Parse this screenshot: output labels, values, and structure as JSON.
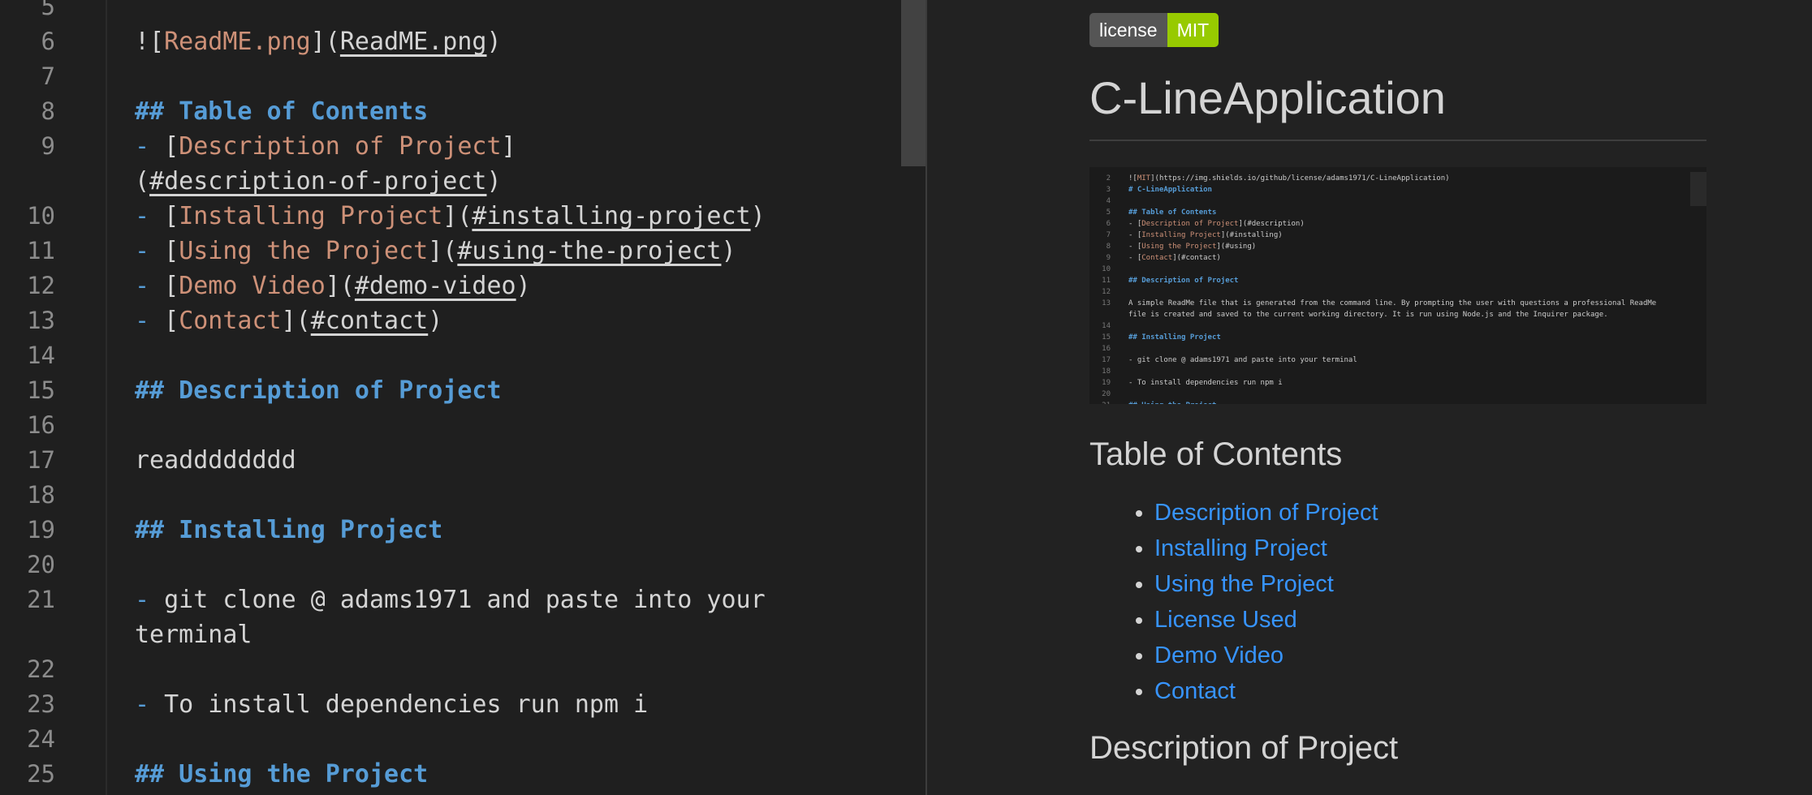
{
  "editor": {
    "lines": [
      {
        "num": "5",
        "segments": []
      },
      {
        "num": "6",
        "segments": [
          {
            "text": "![",
            "cls": ""
          },
          {
            "text": "ReadME.png",
            "cls": "t"
          },
          {
            "text": "](",
            "cls": ""
          },
          {
            "text": "ReadME.png",
            "cls": "u"
          },
          {
            "text": ")",
            "cls": ""
          }
        ]
      },
      {
        "num": "7",
        "segments": []
      },
      {
        "num": "8",
        "segments": [
          {
            "text": "## Table of Contents",
            "cls": "h"
          }
        ]
      },
      {
        "num": "9",
        "segments": [
          {
            "text": "- ",
            "cls": "d"
          },
          {
            "text": "[",
            "cls": ""
          },
          {
            "text": "Description of Project",
            "cls": "t"
          },
          {
            "text": "]",
            "cls": ""
          }
        ]
      },
      {
        "num": "",
        "segments": [
          {
            "text": "(",
            "cls": ""
          },
          {
            "text": "#description-of-project",
            "cls": "u"
          },
          {
            "text": ")",
            "cls": ""
          }
        ]
      },
      {
        "num": "10",
        "segments": [
          {
            "text": "- ",
            "cls": "d"
          },
          {
            "text": "[",
            "cls": ""
          },
          {
            "text": "Installing Project",
            "cls": "t"
          },
          {
            "text": "](",
            "cls": ""
          },
          {
            "text": "#installing-project",
            "cls": "u"
          },
          {
            "text": ")",
            "cls": ""
          }
        ]
      },
      {
        "num": "11",
        "segments": [
          {
            "text": "- ",
            "cls": "d"
          },
          {
            "text": "[",
            "cls": ""
          },
          {
            "text": "Using the Project",
            "cls": "t"
          },
          {
            "text": "](",
            "cls": ""
          },
          {
            "text": "#using-the-project",
            "cls": "u"
          },
          {
            "text": ")",
            "cls": ""
          }
        ]
      },
      {
        "num": "12",
        "segments": [
          {
            "text": "- ",
            "cls": "d"
          },
          {
            "text": "[",
            "cls": ""
          },
          {
            "text": "Demo Video",
            "cls": "t"
          },
          {
            "text": "](",
            "cls": ""
          },
          {
            "text": "#demo-video",
            "cls": "u"
          },
          {
            "text": ")",
            "cls": ""
          }
        ]
      },
      {
        "num": "13",
        "segments": [
          {
            "text": "- ",
            "cls": "d"
          },
          {
            "text": "[",
            "cls": ""
          },
          {
            "text": "Contact",
            "cls": "t"
          },
          {
            "text": "](",
            "cls": ""
          },
          {
            "text": "#contact",
            "cls": "u"
          },
          {
            "text": ")",
            "cls": ""
          }
        ]
      },
      {
        "num": "14",
        "segments": []
      },
      {
        "num": "15",
        "segments": [
          {
            "text": "## Description of Project",
            "cls": "h"
          }
        ]
      },
      {
        "num": "16",
        "segments": []
      },
      {
        "num": "17",
        "segments": [
          {
            "text": "readddddddd",
            "cls": ""
          }
        ]
      },
      {
        "num": "18",
        "segments": []
      },
      {
        "num": "19",
        "segments": [
          {
            "text": "## Installing Project",
            "cls": "h"
          }
        ]
      },
      {
        "num": "20",
        "segments": []
      },
      {
        "num": "21",
        "segments": [
          {
            "text": "- ",
            "cls": "d"
          },
          {
            "text": "git clone @ adams1971 and paste into your",
            "cls": ""
          }
        ]
      },
      {
        "num": "",
        "segments": [
          {
            "text": "terminal",
            "cls": ""
          }
        ]
      },
      {
        "num": "22",
        "segments": []
      },
      {
        "num": "23",
        "segments": [
          {
            "text": "- ",
            "cls": "d"
          },
          {
            "text": "To install dependencies run npm i",
            "cls": ""
          }
        ]
      },
      {
        "num": "24",
        "segments": []
      },
      {
        "num": "25",
        "segments": [
          {
            "text": "## Using the Project",
            "cls": "h"
          }
        ]
      }
    ]
  },
  "preview": {
    "badge_label": "license",
    "badge_value": "MIT",
    "title": "C-LineApplication",
    "screenshot_lines": [
      {
        "num": "2",
        "segments": [
          {
            "text": "![",
            "cls": ""
          },
          {
            "text": "MIT",
            "cls": "s-t"
          },
          {
            "text": "](https://img.shields.io/github/license/adams1971/C-LineApplication)",
            "cls": ""
          }
        ]
      },
      {
        "num": "3",
        "segments": [
          {
            "text": "# C-LineApplication",
            "cls": "s-h"
          }
        ]
      },
      {
        "num": "4",
        "segments": []
      },
      {
        "num": "5",
        "segments": [
          {
            "text": "## Table of Contents",
            "cls": "s-h"
          }
        ]
      },
      {
        "num": "6",
        "segments": [
          {
            "text": "- [",
            "cls": ""
          },
          {
            "text": "Description of Project",
            "cls": "s-t"
          },
          {
            "text": "](#description)",
            "cls": ""
          }
        ]
      },
      {
        "num": "7",
        "segments": [
          {
            "text": "- [",
            "cls": ""
          },
          {
            "text": "Installing Project",
            "cls": "s-t"
          },
          {
            "text": "](#installing)",
            "cls": ""
          }
        ]
      },
      {
        "num": "8",
        "segments": [
          {
            "text": "- [",
            "cls": ""
          },
          {
            "text": "Using the Project",
            "cls": "s-t"
          },
          {
            "text": "](#using)",
            "cls": ""
          }
        ]
      },
      {
        "num": "9",
        "segments": [
          {
            "text": "- [",
            "cls": ""
          },
          {
            "text": "Contact",
            "cls": "s-t"
          },
          {
            "text": "](#contact)",
            "cls": ""
          }
        ]
      },
      {
        "num": "10",
        "segments": []
      },
      {
        "num": "11",
        "segments": [
          {
            "text": "## Description of Project",
            "cls": "s-h"
          }
        ]
      },
      {
        "num": "12",
        "segments": []
      },
      {
        "num": "13",
        "segments": [
          {
            "text": "A simple ReadMe file that is generated from the command line. By prompting the user with questions a professional ReadMe",
            "cls": ""
          }
        ]
      },
      {
        "num": "",
        "segments": [
          {
            "text": "file is created and saved to the current working directory. It is run using Node.js and the Inquirer package.",
            "cls": ""
          }
        ]
      },
      {
        "num": "14",
        "segments": []
      },
      {
        "num": "15",
        "segments": [
          {
            "text": "## Installing Project",
            "cls": "s-h"
          }
        ]
      },
      {
        "num": "16",
        "segments": []
      },
      {
        "num": "17",
        "segments": [
          {
            "text": "- git clone @ adams1971 and paste into your terminal",
            "cls": ""
          }
        ]
      },
      {
        "num": "18",
        "segments": []
      },
      {
        "num": "19",
        "segments": [
          {
            "text": "- To install dependencies run npm i",
            "cls": ""
          }
        ]
      },
      {
        "num": "20",
        "segments": []
      },
      {
        "num": "21",
        "segments": [
          {
            "text": "## Using the Project",
            "cls": "s-h"
          }
        ]
      }
    ],
    "toc_heading": "Table of Contents",
    "toc_items": [
      "Description of Project",
      "Installing Project",
      "Using the Project",
      "License Used",
      "Demo Video",
      "Contact"
    ],
    "description_heading": "Description of Project"
  },
  "colors": {
    "heading": "#569cd6",
    "link_text": "#ce9178",
    "preview_link": "#3794ff",
    "badge_value_bg": "#97ca00"
  }
}
